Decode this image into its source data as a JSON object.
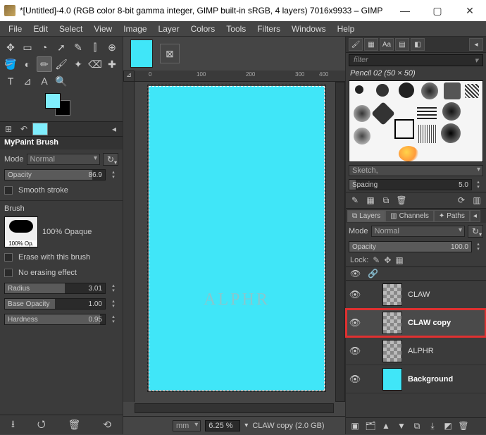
{
  "window": {
    "title": "*[Untitled]-4.0 (RGB color 8-bit gamma integer, GIMP built-in sRGB, 4 layers) 7016x9933 – GIMP",
    "min": "—",
    "max": "▢",
    "close": "✕"
  },
  "menu": [
    "File",
    "Edit",
    "Select",
    "View",
    "Image",
    "Layer",
    "Colors",
    "Tools",
    "Filters",
    "Windows",
    "Help"
  ],
  "toolbox_icons": [
    [
      "✥",
      "▭",
      "◔",
      "➚",
      "✎",
      "⫿",
      "⊕"
    ],
    [
      "🪣",
      "◐",
      "✏",
      "🖌",
      "✦",
      "⌫",
      "✚"
    ],
    [
      "T",
      "⊿",
      "A",
      "🔍"
    ]
  ],
  "tooloptions": {
    "title": "MyPaint Brush",
    "mode_label": "Mode",
    "mode_value": "Normal",
    "opacity_label": "Opacity",
    "opacity_value": "86.9",
    "smooth": "Smooth stroke",
    "brush_label": "Brush",
    "brush_caption": "100% Op.",
    "brush_name": "100% Opaque",
    "erase": "Erase with this brush",
    "noerase": "No erasing effect",
    "radius_label": "Radius",
    "radius_value": "3.01",
    "baseop_label": "Base Opacity",
    "baseop_value": "1.00",
    "hard_label": "Hardness",
    "hard_value": "0.95"
  },
  "statusbar": {
    "unit": "mm",
    "zoom": "6.25 %",
    "info": "CLAW copy (2.0 GB)"
  },
  "canvas": {
    "watermark": "ALPHR",
    "ruler_marks": [
      "0",
      "100",
      "200",
      "300",
      "400"
    ]
  },
  "brushes": {
    "filter_placeholder": "filter",
    "name": "Pencil 02 (50 × 50)",
    "preset": "Sketch,",
    "spacing_label": "Spacing",
    "spacing_value": "5.0"
  },
  "layerpanel": {
    "tabs": [
      "Layers",
      "Channels",
      "Paths"
    ],
    "mode_label": "Mode",
    "mode_value": "Normal",
    "opacity_label": "Opacity",
    "opacity_value": "100.0",
    "lock_label": "Lock:",
    "layers": [
      {
        "eye": "👁",
        "name": "CLAW",
        "thumb": "checker"
      },
      {
        "eye": "👁",
        "name": "CLAW copy",
        "thumb": "checker",
        "selected": true
      },
      {
        "eye": "👁",
        "name": "ALPHR",
        "thumb": "checker"
      },
      {
        "eye": "👁",
        "name": "Background",
        "thumb": "cyan",
        "bold": true
      }
    ]
  }
}
